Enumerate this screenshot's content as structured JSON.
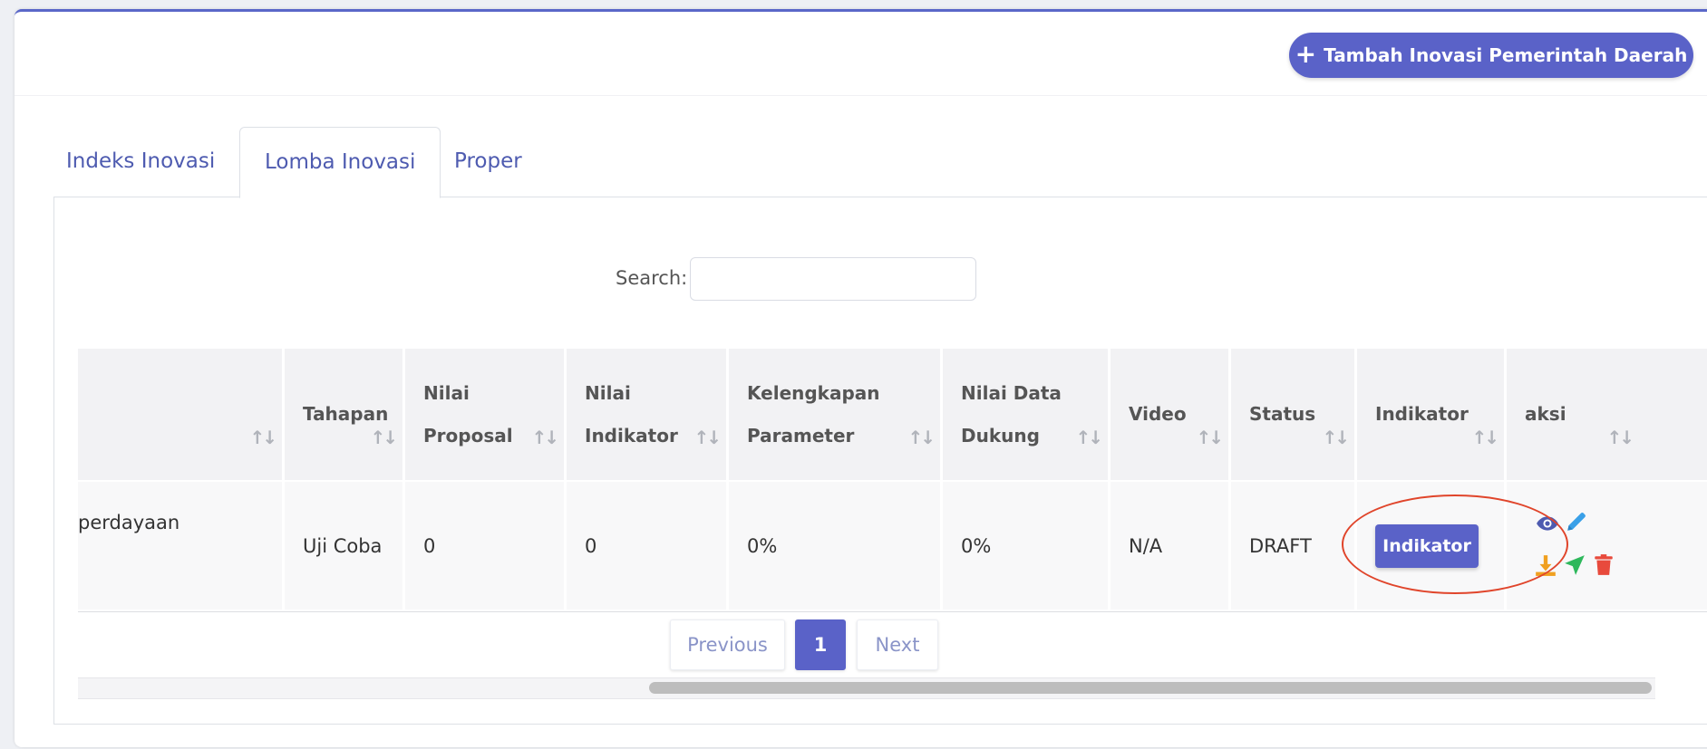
{
  "header": {
    "add_button_label": "Tambah Inovasi Pemerintah Daerah"
  },
  "tabs": [
    {
      "label": "Indeks Inovasi",
      "active": false
    },
    {
      "label": "Lomba Inovasi",
      "active": true
    },
    {
      "label": "Proper",
      "active": false
    }
  ],
  "search": {
    "label": "Search:",
    "placeholder": ""
  },
  "table": {
    "columns": [
      {
        "key": "nama",
        "label": ""
      },
      {
        "key": "tahapan",
        "label": "Tahapan"
      },
      {
        "key": "nilai_proposal",
        "label": "Nilai Proposal"
      },
      {
        "key": "nilai_indikator",
        "label": "Nilai Indikator"
      },
      {
        "key": "kelengkapan",
        "label": "Kelengkapan Parameter"
      },
      {
        "key": "nilai_data",
        "label": "Nilai Data Dukung"
      },
      {
        "key": "video",
        "label": "Video"
      },
      {
        "key": "status",
        "label": "Status"
      },
      {
        "key": "indikator",
        "label": "Indikator"
      },
      {
        "key": "aksi",
        "label": "aksi"
      }
    ],
    "rows": [
      {
        "nama": "perdayaan",
        "tahapan": "Uji Coba",
        "nilai_proposal": "0",
        "nilai_indikator": "0",
        "kelengkapan": "0%",
        "nilai_data": "0%",
        "video": "N/A",
        "status": "DRAFT",
        "indikator_button": "Indikator"
      }
    ]
  },
  "pagination": {
    "previous": "Previous",
    "current": "1",
    "next": "Next"
  },
  "icons": {
    "view": "eye-icon",
    "edit": "pencil-icon",
    "download": "download-icon",
    "send": "send-icon",
    "delete": "trash-icon"
  },
  "colors": {
    "primary": "#5a62c8",
    "link": "#4e5bb0",
    "view_icon": "#4e5bb0",
    "edit_icon": "#3aa0e8",
    "download_icon": "#f0a020",
    "send_icon": "#2eb85c",
    "delete_icon": "#e84a3c",
    "highlight": "#e0452b"
  }
}
